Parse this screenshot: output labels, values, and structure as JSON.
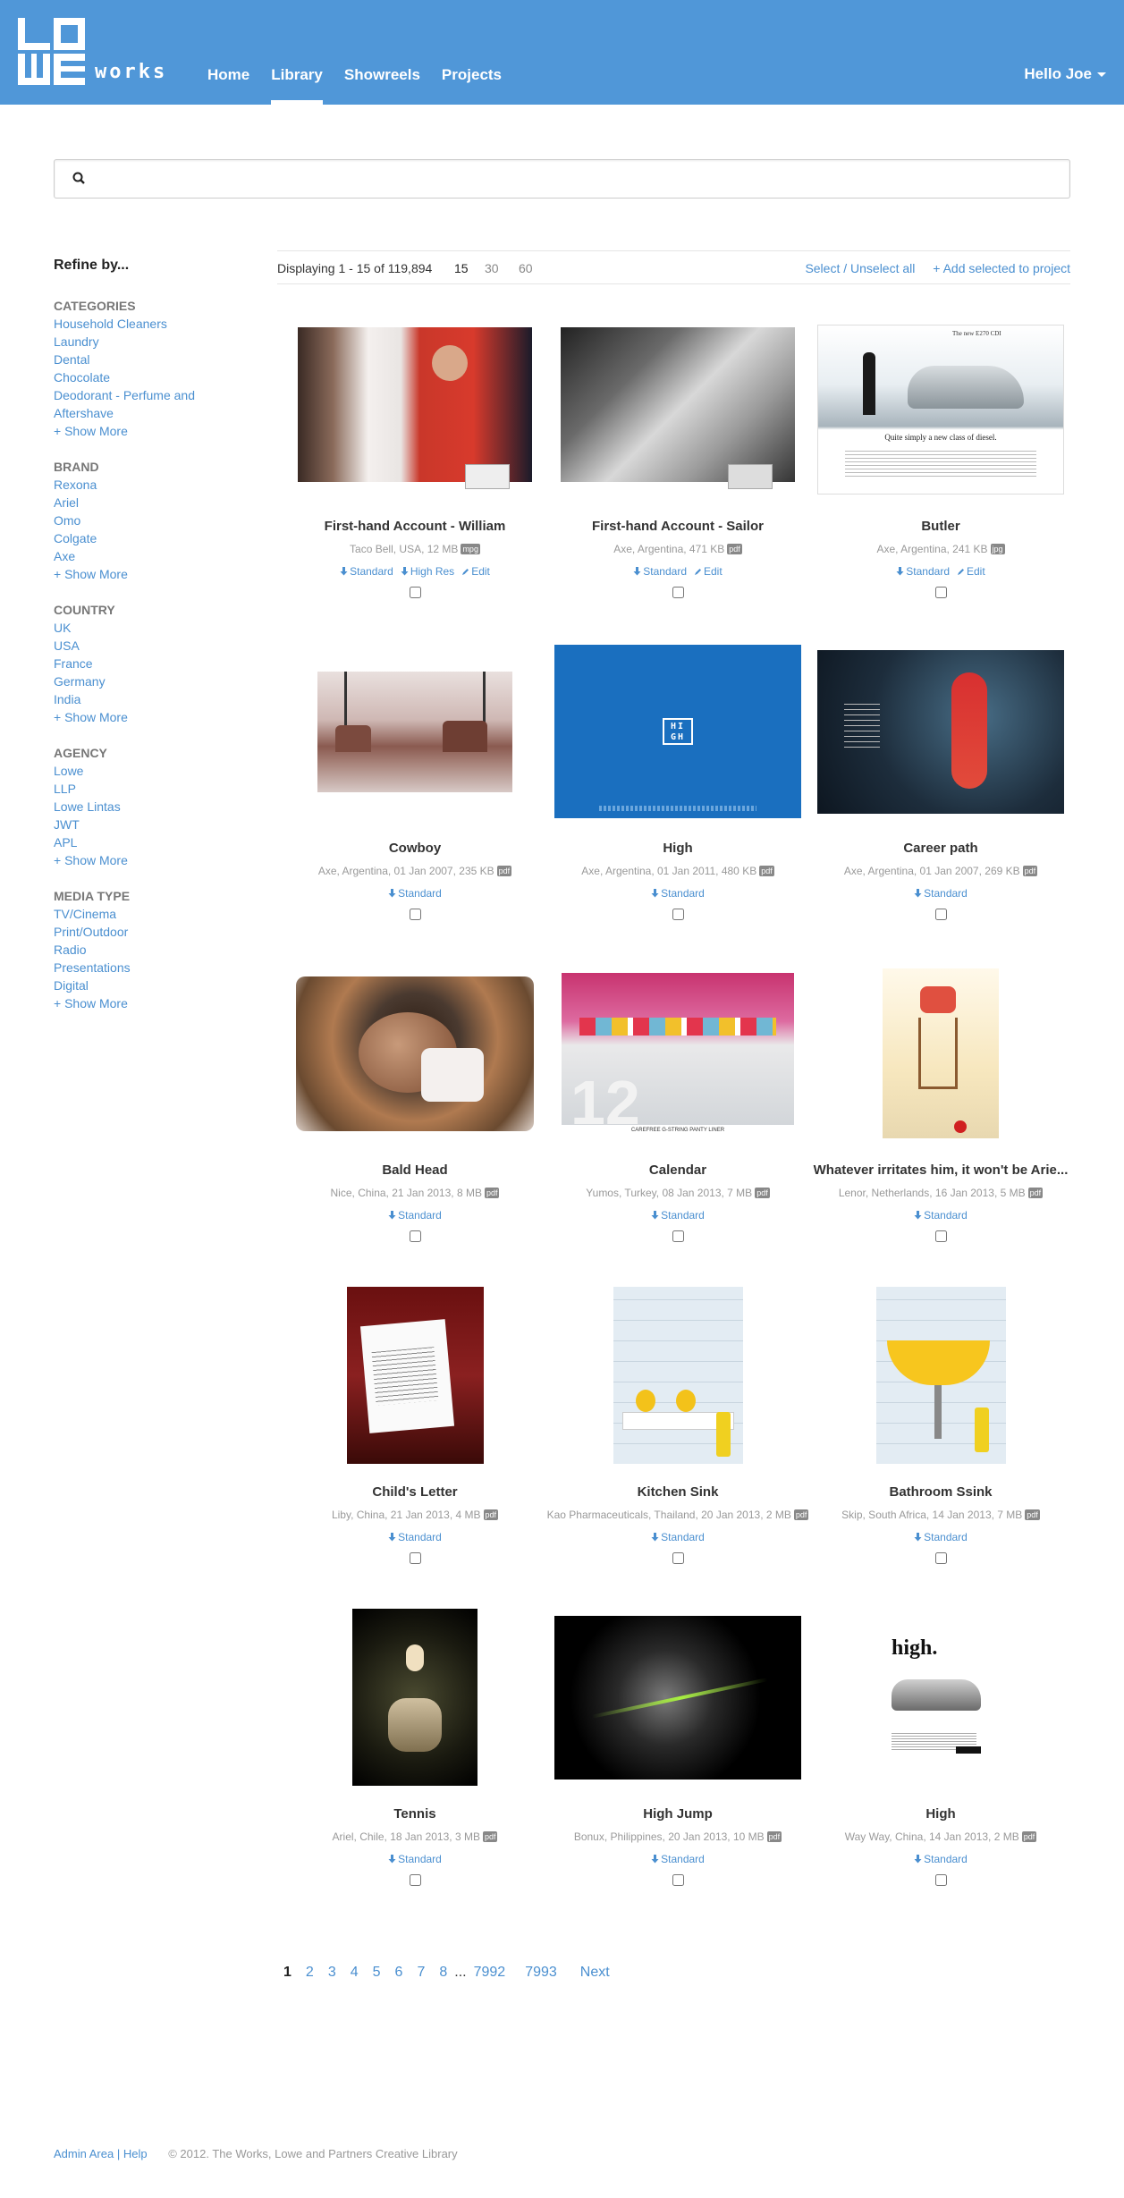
{
  "header": {
    "logo_text": "works",
    "nav": [
      {
        "label": "Home"
      },
      {
        "label": "Library",
        "active": true
      },
      {
        "label": "Showreels"
      },
      {
        "label": "Projects"
      }
    ],
    "user_menu": "Hello Joe",
    "brand_color": "#5097d8"
  },
  "search": {
    "placeholder": "",
    "value": ""
  },
  "sidebar": {
    "title": "Refine by...",
    "facets": [
      {
        "title": "CATEGORIES",
        "items": [
          "Household Cleaners",
          "Laundry",
          "Dental",
          "Chocolate",
          "Deodorant - Perfume and Aftershave"
        ],
        "more": "+ Show More"
      },
      {
        "title": "BRAND",
        "items": [
          "Rexona",
          "Ariel",
          "Omo",
          "Colgate",
          "Axe"
        ],
        "more": "+ Show More"
      },
      {
        "title": "COUNTRY",
        "items": [
          "UK",
          "USA",
          "France",
          "Germany",
          "India"
        ],
        "more": "+ Show More"
      },
      {
        "title": "AGENCY",
        "items": [
          "Lowe",
          "LLP",
          "Lowe Lintas",
          "JWT",
          "APL"
        ],
        "more": "+ Show More"
      },
      {
        "title": "MEDIA TYPE",
        "items": [
          "TV/Cinema",
          "Print/Outdoor",
          "Radio",
          "Presentations",
          "Digital"
        ],
        "more": "+ Show More"
      }
    ]
  },
  "toolbar": {
    "displaying": "Displaying 1 - 15 of 119,894",
    "per_page": [
      "15",
      "30",
      "60"
    ],
    "per_page_selected": "15",
    "select_toggle": "Select / Unselect all",
    "add_to_project": "+ Add selected to project"
  },
  "results": [
    {
      "title": "First-hand Account - William",
      "meta": "Taco Bell, USA, 12 MB",
      "type": "mpg",
      "links": [
        "Standard",
        "High Res",
        "Edit"
      ]
    },
    {
      "title": "First-hand Account - Sailor",
      "meta": "Axe, Argentina, 471 KB",
      "type": "pdf",
      "links": [
        "Standard",
        "Edit"
      ]
    },
    {
      "title": "Butler",
      "meta": "Axe, Argentina, 241 KB",
      "type": "jpg",
      "links": [
        "Standard",
        "Edit"
      ]
    },
    {
      "title": "Cowboy",
      "meta": "Axe, Argentina, 01 Jan 2007, 235 KB",
      "type": "pdf",
      "links": [
        "Standard"
      ]
    },
    {
      "title": "High",
      "meta": "Axe, Argentina, 01 Jan 2011, 480 KB",
      "type": "pdf",
      "links": [
        "Standard"
      ]
    },
    {
      "title": "Career path",
      "meta": "Axe, Argentina, 01 Jan 2007, 269 KB",
      "type": "pdf",
      "links": [
        "Standard"
      ]
    },
    {
      "title": "Bald Head",
      "meta": "Nice, China, 21 Jan 2013, 8 MB",
      "type": "pdf",
      "links": [
        "Standard"
      ]
    },
    {
      "title": "Calendar",
      "meta": "Yumos, Turkey, 08 Jan 2013, 7 MB",
      "type": "pdf",
      "links": [
        "Standard"
      ]
    },
    {
      "title": "Whatever irritates him, it won't be Arie...",
      "meta": "Lenor, Netherlands, 16 Jan 2013, 5 MB",
      "type": "pdf",
      "links": [
        "Standard"
      ]
    },
    {
      "title": "Child's Letter",
      "meta": "Liby, China, 21 Jan 2013, 4 MB",
      "type": "pdf",
      "links": [
        "Standard"
      ]
    },
    {
      "title": "Kitchen Sink",
      "meta": "Kao Pharmaceuticals, Thailand, 20 Jan 2013, 2 MB",
      "type": "pdf",
      "links": [
        "Standard"
      ]
    },
    {
      "title": "Bathroom Ssink",
      "meta": "Skip, South Africa, 14 Jan 2013, 7 MB",
      "type": "pdf",
      "links": [
        "Standard"
      ]
    },
    {
      "title": "Tennis",
      "meta": "Ariel, Chile, 18 Jan 2013, 3 MB",
      "type": "pdf",
      "links": [
        "Standard"
      ]
    },
    {
      "title": "High Jump",
      "meta": "Bonux, Philippines, 20 Jan 2013, 10 MB",
      "type": "pdf",
      "links": [
        "Standard"
      ]
    },
    {
      "title": "High",
      "meta": "Way Way, China, 14 Jan 2013, 2 MB",
      "type": "pdf",
      "links": [
        "Standard"
      ]
    }
  ],
  "thumb_text": {
    "high_logo": "HI GH",
    "butler_headline": "Quite simply a new class of diesel.",
    "high_ad_word": "high.",
    "calendar_footer": "CAREFREE G-STRING PANTY LINER"
  },
  "pagination": {
    "pages": [
      "1",
      "2",
      "3",
      "4",
      "5",
      "6",
      "7",
      "8"
    ],
    "current": "1",
    "ellipsis": "...",
    "last_pages": [
      "7992",
      "7993"
    ],
    "next": "Next"
  },
  "footer": {
    "admin": "Admin Area",
    "sep": "|",
    "help": "Help",
    "copyright": "© 2012. The Works, Lowe and Partners Creative Library"
  }
}
